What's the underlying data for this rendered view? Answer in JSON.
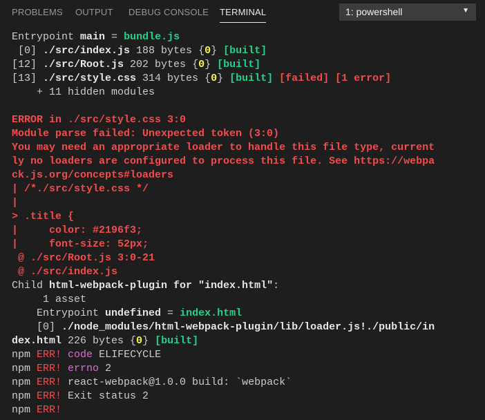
{
  "tabs": {
    "problems": "PROBLEMS",
    "output": "OUTPUT",
    "debug_console": "DEBUG CONSOLE",
    "terminal": "TERMINAL"
  },
  "terminal_select": {
    "selected": "1: powershell",
    "caret": "▼"
  },
  "colors": {
    "background": "#1e1e1e",
    "text": "#cccccc",
    "green": "#23d18b",
    "yellow": "#f5f543",
    "red": "#f14c4c",
    "magenta": "#d670d6"
  },
  "lines": [
    [
      {
        "t": "Entrypoint ",
        "c": ""
      },
      {
        "t": "main",
        "c": "b w"
      },
      {
        "t": " = ",
        "c": ""
      },
      {
        "t": "bundle.js",
        "c": "b g"
      }
    ],
    [
      {
        "t": " [0] ",
        "c": ""
      },
      {
        "t": "./src/index.js",
        "c": "b w"
      },
      {
        "t": " 188 bytes {",
        "c": ""
      },
      {
        "t": "0",
        "c": "b y"
      },
      {
        "t": "} ",
        "c": ""
      },
      {
        "t": "[built]",
        "c": "b g"
      }
    ],
    [
      {
        "t": "[12] ",
        "c": ""
      },
      {
        "t": "./src/Root.js",
        "c": "b w"
      },
      {
        "t": " 202 bytes {",
        "c": ""
      },
      {
        "t": "0",
        "c": "b y"
      },
      {
        "t": "} ",
        "c": ""
      },
      {
        "t": "[built]",
        "c": "b g"
      }
    ],
    [
      {
        "t": "[13] ",
        "c": ""
      },
      {
        "t": "./src/style.css",
        "c": "b w"
      },
      {
        "t": " 314 bytes {",
        "c": ""
      },
      {
        "t": "0",
        "c": "b y"
      },
      {
        "t": "} ",
        "c": ""
      },
      {
        "t": "[built]",
        "c": "b g"
      },
      {
        "t": " ",
        "c": ""
      },
      {
        "t": "[failed]",
        "c": "b r"
      },
      {
        "t": " ",
        "c": ""
      },
      {
        "t": "[1 error]",
        "c": "b r"
      }
    ],
    [
      {
        "t": "    + 11 hidden modules",
        "c": ""
      }
    ],
    [],
    [
      {
        "t": "ERROR in ./src/style.css 3:0",
        "c": "b r"
      }
    ],
    [
      {
        "t": "Module parse failed: Unexpected token (3:0)",
        "c": "b r"
      }
    ],
    [
      {
        "t": "You may need an appropriate loader to handle this file type, current",
        "c": "b r"
      }
    ],
    [
      {
        "t": "ly no loaders are configured to process this file. See https://webpa",
        "c": "b r"
      }
    ],
    [
      {
        "t": "ck.js.org/concepts#loaders",
        "c": "b r"
      }
    ],
    [
      {
        "t": "| /*./src/style.css */",
        "c": "b r"
      }
    ],
    [
      {
        "t": "|",
        "c": "b r"
      }
    ],
    [
      {
        "t": "> .title {",
        "c": "b r"
      }
    ],
    [
      {
        "t": "|     color: #2196f3;",
        "c": "b r"
      }
    ],
    [
      {
        "t": "|     font-size: 52px;",
        "c": "b r"
      }
    ],
    [
      {
        "t": " @ ./src/Root.js 3:0-21",
        "c": "b r"
      }
    ],
    [
      {
        "t": " @ ./src/index.js",
        "c": "b r"
      }
    ],
    [
      {
        "t": "Child ",
        "c": ""
      },
      {
        "t": "html-webpack-plugin for \"index.html\"",
        "c": "b w"
      },
      {
        "t": ":",
        "c": ""
      }
    ],
    [
      {
        "t": "     1 asset",
        "c": ""
      }
    ],
    [
      {
        "t": "    Entrypoint ",
        "c": ""
      },
      {
        "t": "undefined",
        "c": "b w"
      },
      {
        "t": " = ",
        "c": ""
      },
      {
        "t": "index.html",
        "c": "b g"
      }
    ],
    [
      {
        "t": "    [0] ",
        "c": ""
      },
      {
        "t": "./node_modules/html-webpack-plugin/lib/loader.js!./public/in",
        "c": "b w"
      }
    ],
    [
      {
        "t": "dex.html",
        "c": "b w"
      },
      {
        "t": " 226 bytes {",
        "c": ""
      },
      {
        "t": "0",
        "c": "b y"
      },
      {
        "t": "} ",
        "c": ""
      },
      {
        "t": "[built]",
        "c": "b g"
      }
    ],
    [
      {
        "t": "npm ",
        "c": ""
      },
      {
        "t": "ERR!",
        "c": "r"
      },
      {
        "t": " ",
        "c": ""
      },
      {
        "t": "code",
        "c": "m"
      },
      {
        "t": " ELIFECYCLE",
        "c": ""
      }
    ],
    [
      {
        "t": "npm ",
        "c": ""
      },
      {
        "t": "ERR!",
        "c": "r"
      },
      {
        "t": " ",
        "c": ""
      },
      {
        "t": "errno",
        "c": "m"
      },
      {
        "t": " 2",
        "c": ""
      }
    ],
    [
      {
        "t": "npm ",
        "c": ""
      },
      {
        "t": "ERR!",
        "c": "r"
      },
      {
        "t": " react-webpack@1.0.0 build: `webpack`",
        "c": ""
      }
    ],
    [
      {
        "t": "npm ",
        "c": ""
      },
      {
        "t": "ERR!",
        "c": "r"
      },
      {
        "t": " Exit status 2",
        "c": ""
      }
    ],
    [
      {
        "t": "npm ",
        "c": ""
      },
      {
        "t": "ERR!",
        "c": "r"
      }
    ]
  ]
}
